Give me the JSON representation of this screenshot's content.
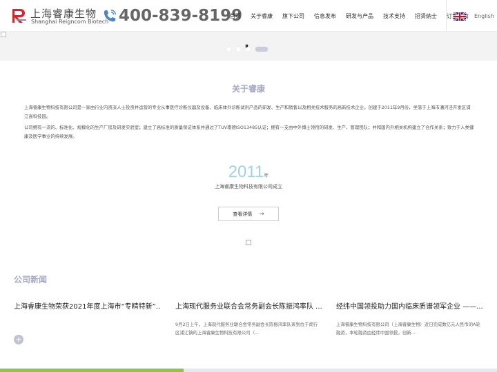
{
  "header": {
    "logo_cn": "上海睿康生物",
    "logo_en": "Shanghai Reigncom Biotech",
    "hotline": "400-839-8199",
    "nav": [
      "首页",
      "关于睿康",
      "旗下公司",
      "信息发布",
      "研发与产品",
      "技术支持",
      "招贤纳士",
      "订货指南"
    ],
    "language": "English",
    "icons": {
      "logo": "r-logo-icon",
      "phone": "phone-icon",
      "flag": "uk-flag-icon"
    }
  },
  "banner": {
    "slides": 4,
    "active_slide": 4,
    "pause_glyph": "⏸"
  },
  "about": {
    "title": "关于睿康",
    "para1": "上海睿康生物科技有限公司是一家由行业内资深人士投资并运营的专业从事医疗诊断仪器及设备、临床体外诊断试剂产品的研发、生产和销售以及相关技术服务的高新技术企业。创建于2011年9月份，坐落于上海市漕河泾开发区浦江高科技园。",
    "para2": "公司拥有一流的、标准化、规模化的生产厂房及研发实验室；建立了高标准的质量保证体系并通过了TUV南德ISO13485认证；拥有一支由中外博士领衔的研发、生产、管理团队；并和国内外相关机构建立了合作关系；致力于人类健康及医学事业的持续发展。",
    "year": "2011",
    "year_unit": "年",
    "year_desc": "上海睿康生物科技有限公司成立",
    "more_label": "查看详情",
    "more_arrow": "→"
  },
  "news": {
    "title": "公司新闻",
    "items": [
      {
        "title": "上海睿康生物荣获2021年度上海市“专精特新”...",
        "body": ""
      },
      {
        "title": "上海现代服务业联合会常务副会长陈振鸿率队 ...",
        "body": "9月2日上午，上海现代服务业联合会常务副会长陈振鸿率队来到位于闵行区浦江镇的上海睿康生物科技有限公司（..."
      },
      {
        "title": "经纬中国领投助力国内临床质谱领军企业 ——...",
        "body": "上海睿康生物科技有限公司（上海睿康生物）近日完成数亿元人民币的A轮融资，本轮融资由经纬中国领投，创新..."
      }
    ],
    "plus_label": "+"
  },
  "progress": {
    "fraction": 0.37
  },
  "colors": {
    "accent_title": "#a4a7c2",
    "year": "#9fd2e6",
    "logo_red": "#d9232d",
    "progress": "#8dc63f"
  }
}
